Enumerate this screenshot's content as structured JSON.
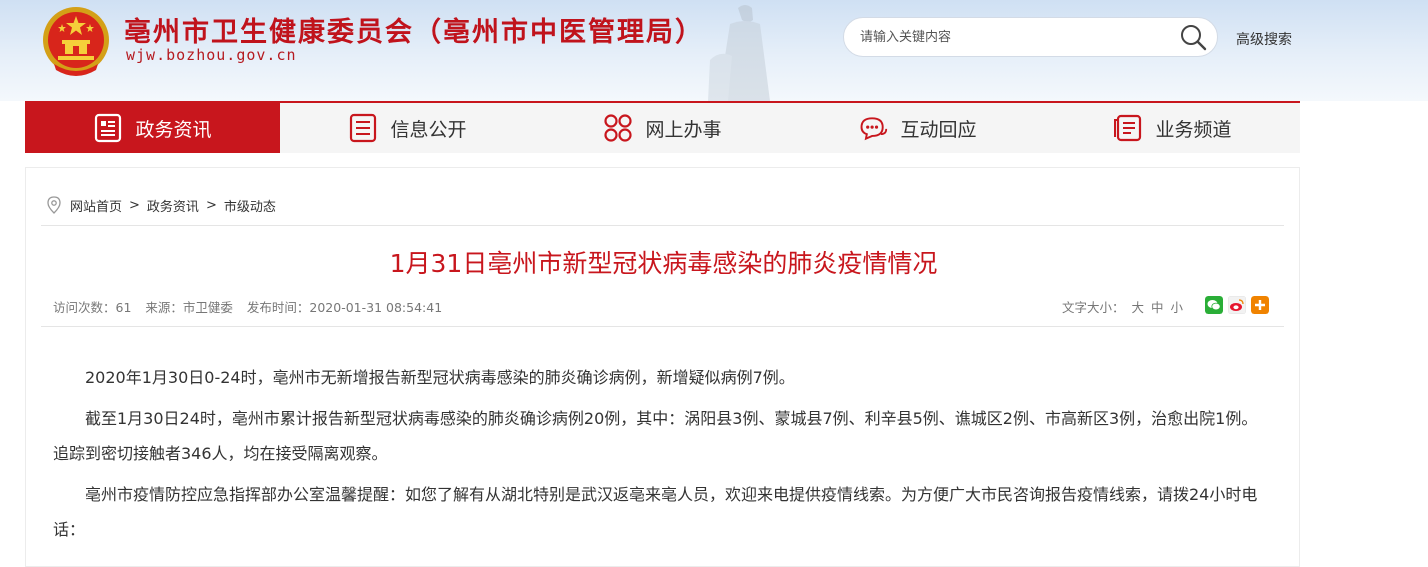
{
  "header": {
    "site_title": "亳州市卫生健康委员会（亳州市中医管理局）",
    "site_domain": "wjw.bozhou.gov.cn",
    "search": {
      "placeholder": "请输入关键内容",
      "value": ""
    },
    "advanced_search_label": "高级搜索"
  },
  "nav": {
    "items": [
      {
        "label": "政务资讯",
        "icon": "news-icon",
        "active": true
      },
      {
        "label": "信息公开",
        "icon": "list-icon",
        "active": false
      },
      {
        "label": "网上办事",
        "icon": "apps-icon",
        "active": false
      },
      {
        "label": "互动回应",
        "icon": "chat-icon",
        "active": false
      },
      {
        "label": "业务频道",
        "icon": "document-icon",
        "active": false
      }
    ]
  },
  "breadcrumb": [
    "网站首页",
    "政务资讯",
    "市级动态"
  ],
  "breadcrumb_sep": ">",
  "article": {
    "title": "1月31日亳州市新型冠状病毒感染的肺炎疫情情况",
    "meta": {
      "visits": "访问次数：61",
      "source": "来源：市卫健委",
      "published": "发布时间：2020-01-31 08:54:41"
    },
    "font_size": {
      "label": "文字大小：",
      "large": "大",
      "medium": "中",
      "small": "小"
    },
    "share": [
      {
        "icon": "wechat-icon",
        "color": "#2aae37"
      },
      {
        "icon": "weibo-icon",
        "color": "#e6162d"
      },
      {
        "icon": "more-share-icon",
        "color": "#f08300"
      }
    ],
    "paragraphs": [
      "2020年1月30日0-24时，亳州市无新增报告新型冠状病毒感染的肺炎确诊病例，新增疑似病例7例。",
      "截至1月30日24时，亳州市累计报告新型冠状病毒感染的肺炎确诊病例20例，其中：涡阳县3例、蒙城县7例、利辛县5例、谯城区2例、市高新区3例，治愈出院1例。追踪到密切接触者346人，均在接受隔离观察。",
      "亳州市疫情防控应急指挥部办公室温馨提醒：如您了解有从湖北特别是武汉返亳来亳人员，欢迎来电提供疫情线索。为方便广大市民咨询报告疫情线索，请拨24小时电话："
    ]
  },
  "colors": {
    "brand_red": "#c8161d",
    "header_bg": "#dbe7f5",
    "nav_bg": "#f5f5f5"
  }
}
